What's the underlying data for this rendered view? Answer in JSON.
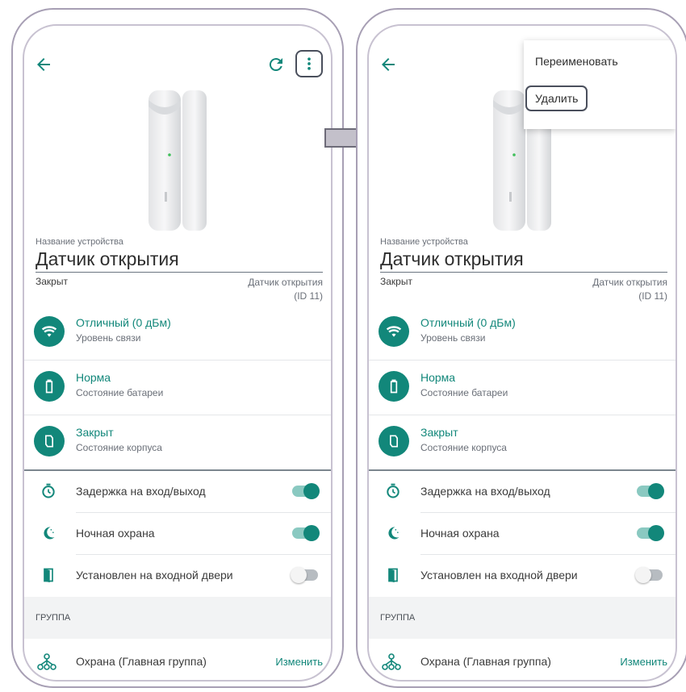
{
  "screens": [
    {
      "device_name_label": "Название устройства",
      "device_name": "Датчик открытия",
      "state": "Закрыт",
      "device_type": "Датчик открытия",
      "device_id": "(ID 11)",
      "status_items": [
        {
          "title": "Отличный (0 дБм)",
          "subtitle": "Уровень связи"
        },
        {
          "title": "Норма",
          "subtitle": "Состояние батареи"
        },
        {
          "title": "Закрыт",
          "subtitle": "Состояние корпуса"
        }
      ],
      "toggles": [
        {
          "label": "Задержка на вход/выход",
          "on": true
        },
        {
          "label": "Ночная охрана",
          "on": true
        },
        {
          "label": "Установлен на входной двери",
          "on": false
        }
      ],
      "group_label": "ГРУППА",
      "group_name": "Охрана (Главная группа)",
      "change_label": "Изменить"
    },
    {
      "device_name_label": "Название устройства",
      "device_name": "Датчик открытия",
      "state": "Закрыт",
      "device_type": "Датчик открытия",
      "device_id": "(ID 11)",
      "status_items": [
        {
          "title": "Отличный (0 дБм)",
          "subtitle": "Уровень связи"
        },
        {
          "title": "Норма",
          "subtitle": "Состояние батареи"
        },
        {
          "title": "Закрыт",
          "subtitle": "Состояние корпуса"
        }
      ],
      "toggles": [
        {
          "label": "Задержка на вход/выход",
          "on": true
        },
        {
          "label": "Ночная охрана",
          "on": true
        },
        {
          "label": "Установлен на входной двери",
          "on": false
        }
      ],
      "group_label": "ГРУППА",
      "group_name": "Охрана (Главная группа)",
      "change_label": "Изменить",
      "menu": {
        "rename": "Переименовать",
        "delete": "Удалить"
      }
    }
  ],
  "colors": {
    "accent": "#12877a",
    "frame": "#a79fb4"
  },
  "icons": {
    "back": "arrow-left-icon",
    "refresh": "refresh-icon",
    "more": "more-vertical-icon",
    "signal": "wifi-icon",
    "battery": "battery-icon",
    "case": "case-icon",
    "delay": "timer-icon",
    "night": "moon-icon",
    "door": "door-icon",
    "group": "group-icon",
    "transition": "right-arrow-icon"
  }
}
